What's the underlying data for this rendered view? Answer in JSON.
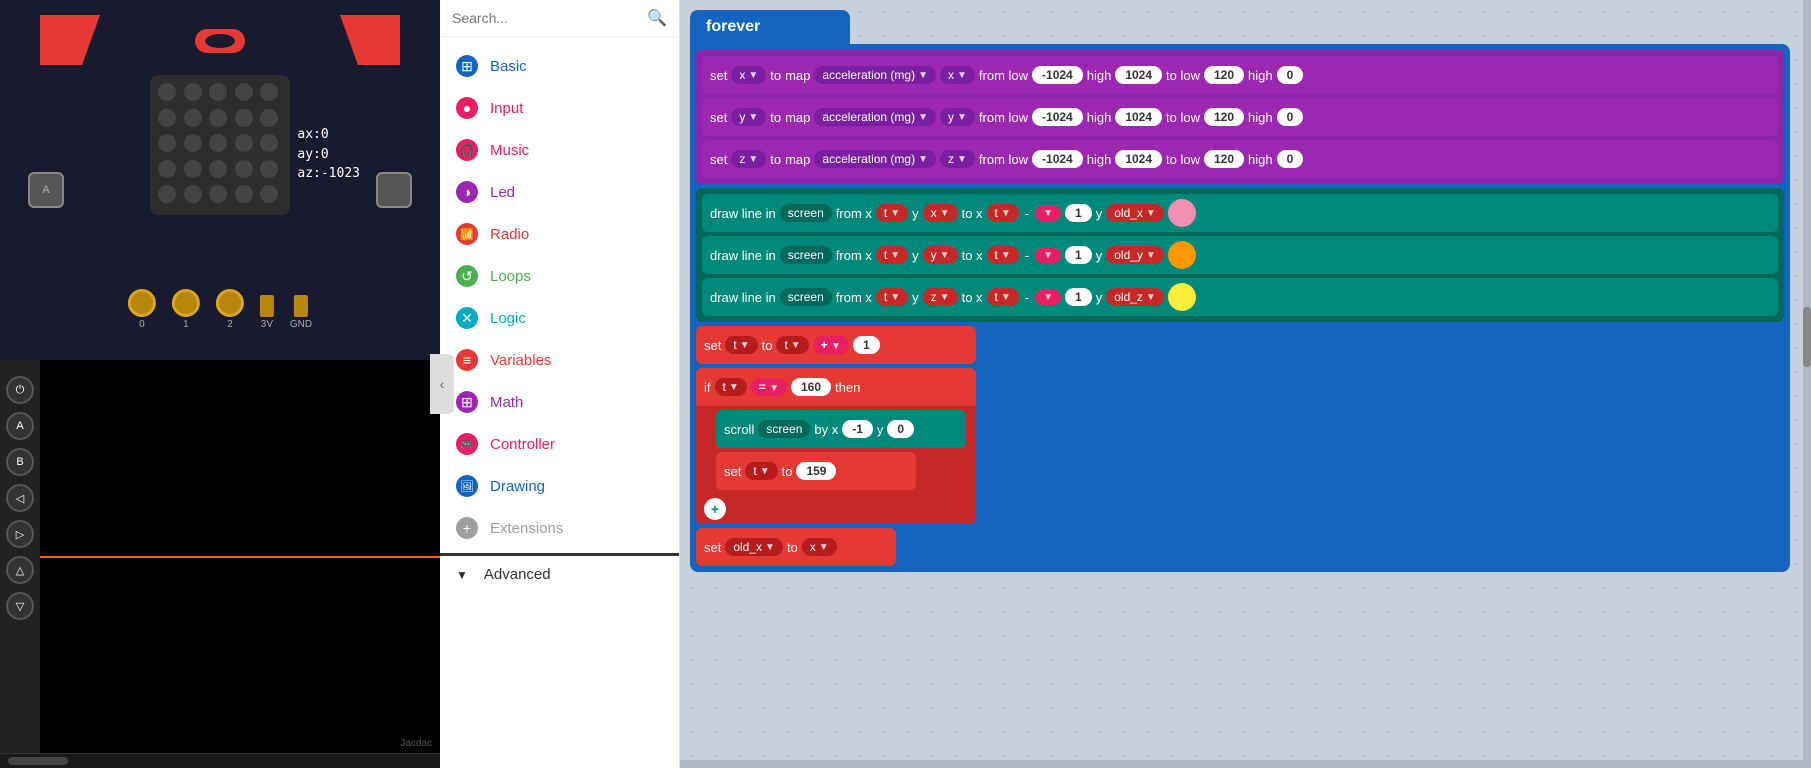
{
  "leftPanel": {
    "axReadings": {
      "ax": "ax:0",
      "ay": "ay:0",
      "az": "az:-1023"
    },
    "buttonA": "A",
    "buttonB": "B",
    "labelB": "B",
    "connectorPins": [
      "0",
      "1",
      "2",
      "3V",
      "GND"
    ],
    "consoleButtons": [
      "⏻",
      "A",
      "B",
      "◁",
      "▷",
      "△",
      "▽"
    ],
    "jacdacLabel": "Jacdac"
  },
  "middlePanel": {
    "searchPlaceholder": "Search...",
    "categories": [
      {
        "id": "basic",
        "label": "Basic",
        "color": "#1565c0",
        "icon": "⊞"
      },
      {
        "id": "input",
        "label": "Input",
        "color": "#e91e63",
        "icon": "●"
      },
      {
        "id": "music",
        "label": "Music",
        "color": "#e91e63",
        "icon": "🎧"
      },
      {
        "id": "led",
        "label": "Led",
        "color": "#9c27b0",
        "icon": "◑"
      },
      {
        "id": "radio",
        "label": "Radio",
        "color": "#e53935",
        "icon": "📶"
      },
      {
        "id": "loops",
        "label": "Loops",
        "color": "#4caf50",
        "icon": "↺"
      },
      {
        "id": "logic",
        "label": "Logic",
        "color": "#00acc1",
        "icon": "✕"
      },
      {
        "id": "variables",
        "label": "Variables",
        "color": "#e53935",
        "icon": "≡"
      },
      {
        "id": "math",
        "label": "Math",
        "color": "#9c27b0",
        "icon": "⊞"
      },
      {
        "id": "controller",
        "label": "Controller",
        "color": "#e91e63",
        "icon": "🎮"
      },
      {
        "id": "drawing",
        "label": "Drawing",
        "color": "#1565c0",
        "icon": "🖼"
      },
      {
        "id": "extensions",
        "label": "Extensions",
        "color": "#9e9e9e",
        "icon": "+"
      }
    ],
    "advanced": {
      "label": "Advanced",
      "arrow": "▼"
    }
  },
  "rightPanel": {
    "foreverLabel": "forever",
    "blocks": [
      {
        "type": "set-var",
        "color": "purple",
        "var": "x",
        "action": "to",
        "fn": "map",
        "accelType": "acceleration (mg)",
        "accelAxis": "x",
        "fromLow": "-1024",
        "high1": "1024",
        "toLow": "120",
        "high2": "0"
      },
      {
        "type": "set-var",
        "color": "purple",
        "var": "y",
        "action": "to",
        "fn": "map",
        "accelType": "acceleration (mg)",
        "accelAxis": "y",
        "fromLow": "-1024",
        "high1": "1024",
        "toLow": "120",
        "high2": "0"
      },
      {
        "type": "set-var",
        "color": "purple",
        "var": "z",
        "action": "to",
        "fn": "map",
        "accelType": "acceleration (mg)",
        "accelAxis": "z",
        "fromLow": "-1024",
        "high1": "1024",
        "toLow": "120",
        "high2": "0"
      }
    ],
    "drawLines": [
      {
        "var1": "t",
        "var2": "x",
        "toX": "t",
        "minus": "1",
        "toY": "old_x",
        "dotColor": "pink"
      },
      {
        "var1": "t",
        "var2": "y",
        "toX": "t",
        "minus": "1",
        "toY": "old_y",
        "dotColor": "orange"
      },
      {
        "var1": "t",
        "var2": "z",
        "toX": "t",
        "minus": "1",
        "toY": "old_z",
        "dotColor": "yellow"
      }
    ],
    "setT": {
      "var": "t",
      "op": "+",
      "val": "1"
    },
    "ifBlock": {
      "var": "t",
      "eq": "=",
      "val": "160",
      "then": "then"
    },
    "scrollBlock": {
      "axis": "x",
      "val1": "-1",
      "axis2": "y",
      "val2": "0"
    },
    "setT159": {
      "var": "t",
      "val": "159"
    },
    "setOldX": {
      "var": "old_x",
      "val": "x"
    },
    "screenLabel": "screen",
    "fromLabel": "from",
    "drawLineIn": "draw line in",
    "screenFrom": "screen from"
  }
}
